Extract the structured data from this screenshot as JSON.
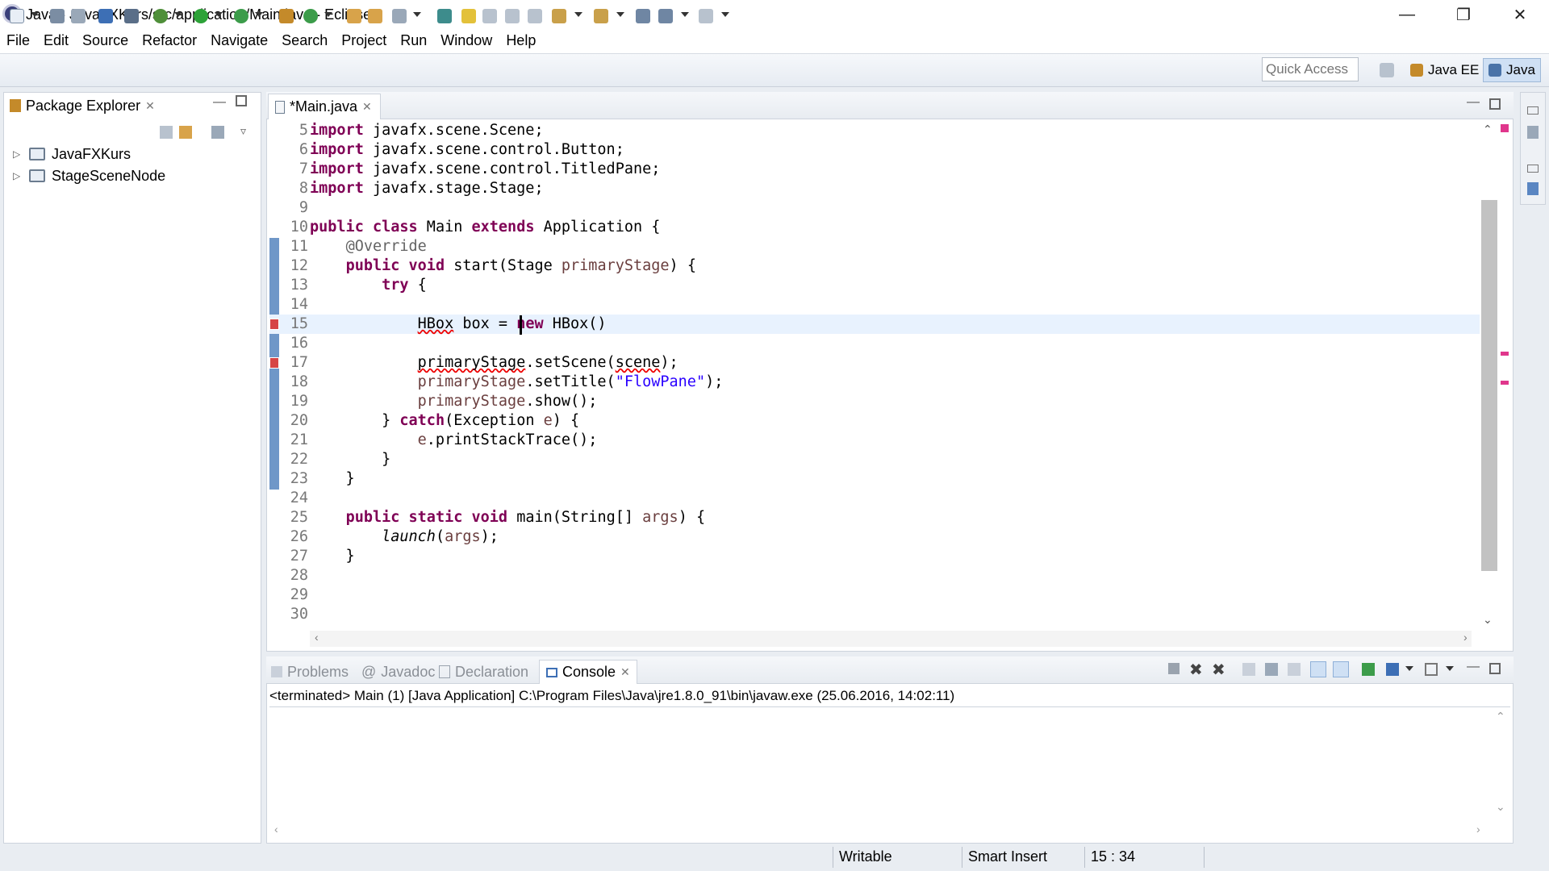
{
  "window": {
    "title": "Java - JavaFXKurs/src/application/Main.java - Eclipse",
    "icons": {
      "minimize": "minimize-icon",
      "restore": "restore-icon",
      "close": "close-icon"
    }
  },
  "menubar": [
    "File",
    "Edit",
    "Source",
    "Refactor",
    "Navigate",
    "Search",
    "Project",
    "Run",
    "Window",
    "Help"
  ],
  "toolbar": {
    "quick_access_placeholder": "Quick Access",
    "perspectives": [
      "Java EE",
      "Java"
    ],
    "active_perspective": "Java"
  },
  "package_explorer": {
    "title": "Package Explorer",
    "projects": [
      "JavaFXKurs",
      "StageSceneNode"
    ]
  },
  "editor": {
    "tab_label": "*Main.java",
    "current_line": 15,
    "lines": [
      {
        "n": "5",
        "tokens": [
          [
            "kw",
            "import"
          ],
          [
            "t",
            " javafx.scene.Scene;"
          ]
        ]
      },
      {
        "n": "6",
        "tokens": [
          [
            "kw",
            "import"
          ],
          [
            "t",
            " javafx.scene.control.Button;"
          ]
        ]
      },
      {
        "n": "7",
        "tokens": [
          [
            "kw",
            "import"
          ],
          [
            "t",
            " javafx.scene.control.TitledPane;"
          ]
        ]
      },
      {
        "n": "8",
        "tokens": [
          [
            "kw",
            "import"
          ],
          [
            "t",
            " javafx.stage.Stage;"
          ]
        ]
      },
      {
        "n": "9",
        "tokens": []
      },
      {
        "n": "10",
        "tokens": [
          [
            "kw",
            "public"
          ],
          [
            "t",
            " "
          ],
          [
            "kw",
            "class"
          ],
          [
            "t",
            " Main "
          ],
          [
            "kw",
            "extends"
          ],
          [
            "t",
            " Application {"
          ]
        ]
      },
      {
        "n": "11",
        "tokens": [
          [
            "t",
            "    "
          ],
          [
            "ann",
            "@Override"
          ]
        ]
      },
      {
        "n": "12",
        "tokens": [
          [
            "t",
            "    "
          ],
          [
            "kw",
            "public"
          ],
          [
            "t",
            " "
          ],
          [
            "kw",
            "void"
          ],
          [
            "t",
            " start(Stage "
          ],
          [
            "param",
            "primaryStage"
          ],
          [
            "t",
            ") {"
          ]
        ]
      },
      {
        "n": "13",
        "tokens": [
          [
            "t",
            "        "
          ],
          [
            "kw",
            "try"
          ],
          [
            "t",
            " {"
          ]
        ]
      },
      {
        "n": "14",
        "tokens": []
      },
      {
        "n": "15",
        "tokens": [
          [
            "t",
            "            "
          ],
          [
            "err",
            "HBox"
          ],
          [
            "t",
            " box = "
          ],
          [
            "kw",
            "new"
          ],
          [
            "t",
            " HBox()"
          ]
        ]
      },
      {
        "n": "16",
        "tokens": []
      },
      {
        "n": "17",
        "tokens": [
          [
            "t",
            "            "
          ],
          [
            "err",
            "primaryStage"
          ],
          [
            "t",
            ".setScene("
          ],
          [
            "err",
            "scene"
          ],
          [
            "t",
            ");"
          ]
        ]
      },
      {
        "n": "18",
        "tokens": [
          [
            "t",
            "            "
          ],
          [
            "param",
            "primaryStage"
          ],
          [
            "t",
            ".setTitle("
          ],
          [
            "str",
            "\"FlowPane\""
          ],
          [
            "t",
            ");"
          ]
        ]
      },
      {
        "n": "19",
        "tokens": [
          [
            "t",
            "            "
          ],
          [
            "param",
            "primaryStage"
          ],
          [
            "t",
            ".show();"
          ]
        ]
      },
      {
        "n": "20",
        "tokens": [
          [
            "t",
            "        } "
          ],
          [
            "kw",
            "catch"
          ],
          [
            "t",
            "(Exception "
          ],
          [
            "param",
            "e"
          ],
          [
            "t",
            ") {"
          ]
        ]
      },
      {
        "n": "21",
        "tokens": [
          [
            "t",
            "            "
          ],
          [
            "param",
            "e"
          ],
          [
            "t",
            ".printStackTrace();"
          ]
        ]
      },
      {
        "n": "22",
        "tokens": [
          [
            "t",
            "        }"
          ]
        ]
      },
      {
        "n": "23",
        "tokens": [
          [
            "t",
            "    }"
          ]
        ]
      },
      {
        "n": "24",
        "tokens": []
      },
      {
        "n": "25",
        "tokens": [
          [
            "t",
            "    "
          ],
          [
            "kw",
            "public"
          ],
          [
            "t",
            " "
          ],
          [
            "kw",
            "static"
          ],
          [
            "t",
            " "
          ],
          [
            "kw",
            "void"
          ],
          [
            "t",
            " main(String[] "
          ],
          [
            "param",
            "args"
          ],
          [
            "t",
            ") {"
          ]
        ]
      },
      {
        "n": "26",
        "tokens": [
          [
            "t",
            "        "
          ],
          [
            "italic",
            "launch"
          ],
          [
            "t",
            "("
          ],
          [
            "param",
            "args"
          ],
          [
            "t",
            ");"
          ]
        ]
      },
      {
        "n": "27",
        "tokens": [
          [
            "t",
            "    }"
          ]
        ]
      },
      {
        "n": "28",
        "tokens": []
      },
      {
        "n": "29",
        "tokens": []
      },
      {
        "n": "30",
        "tokens": []
      }
    ]
  },
  "bottom_panel": {
    "tabs": [
      "Problems",
      "Javadoc",
      "Declaration",
      "Console"
    ],
    "active_tab": "Console",
    "console_status": "<terminated> Main (1) [Java Application] C:\\Program Files\\Java\\jre1.8.0_91\\bin\\javaw.exe (25.06.2016, 14:02:11)"
  },
  "statusbar": {
    "writable": "Writable",
    "insert_mode": "Smart Insert",
    "position": "15 : 34"
  },
  "colors": {
    "keyword": "#7f0055",
    "string": "#2a00ff",
    "annotation": "#646464",
    "error": "#e00000",
    "selection_bar": "#6f97c8"
  }
}
